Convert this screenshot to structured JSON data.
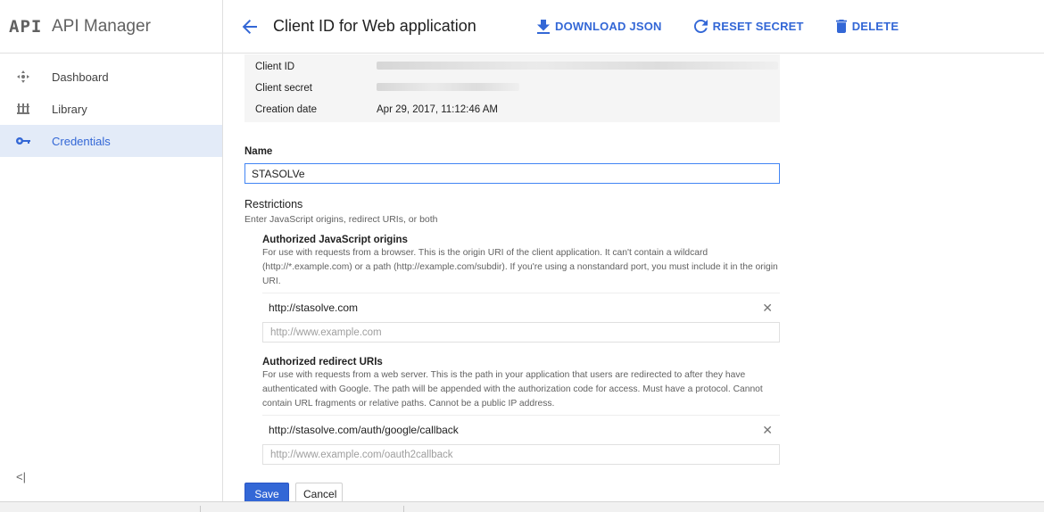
{
  "brand": {
    "logo": "API",
    "title": "API Manager"
  },
  "sidebar": {
    "items": [
      {
        "label": "Dashboard",
        "icon": "dashboard-icon",
        "active": false
      },
      {
        "label": "Library",
        "icon": "library-icon",
        "active": false
      },
      {
        "label": "Credentials",
        "icon": "key-icon",
        "active": true
      }
    ],
    "collapse_label": "<|"
  },
  "header": {
    "title": "Client ID for Web application",
    "actions": {
      "download": "DOWNLOAD JSON",
      "reset": "RESET SECRET",
      "delete": "DELETE"
    }
  },
  "colors": {
    "accent": "#3367d6",
    "active_bg": "#e3ebf8",
    "input_focus": "#4285f4"
  },
  "client_info": {
    "client_id_label": "Client ID",
    "client_secret_label": "Client secret",
    "creation_date_label": "Creation date",
    "creation_date_value": "Apr 29, 2017, 11:12:46 AM"
  },
  "name_field": {
    "label": "Name",
    "value": "STASOLVe"
  },
  "restrictions": {
    "title": "Restrictions",
    "subtitle": "Enter JavaScript origins, redirect URIs, or both",
    "js_origins": {
      "title": "Authorized JavaScript origins",
      "description": "For use with requests from a browser. This is the origin URI of the client application. It can't contain a wildcard (http://*.example.com) or a path (http://example.com/subdir). If you're using a nonstandard port, you must include it in the origin URI.",
      "entry": "http://stasolve.com",
      "placeholder": "http://www.example.com"
    },
    "redirect_uris": {
      "title": "Authorized redirect URIs",
      "description": "For use with requests from a web server. This is the path in your application that users are redirected to after they have authenticated with Google. The path will be appended with the authorization code for access. Must have a protocol. Cannot contain URL fragments or relative paths. Cannot be a public IP address.",
      "entry": "http://stasolve.com/auth/google/callback",
      "placeholder": "http://www.example.com/oauth2callback"
    }
  },
  "buttons": {
    "save": "Save",
    "cancel": "Cancel"
  }
}
